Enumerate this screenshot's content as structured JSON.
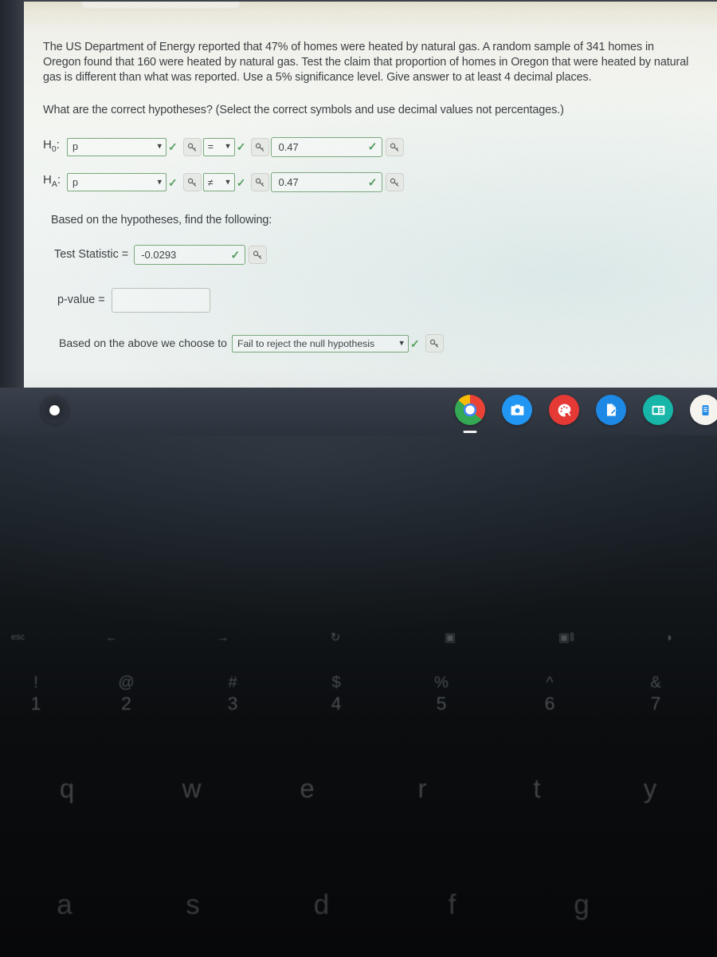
{
  "browser": {
    "page_background": "#f1f5f2",
    "ghost_widget_text": ""
  },
  "problem": {
    "statement": "The US Department of Energy reported that 47% of homes were heated by natural gas. A random sample of 341 homes in Oregon found that 160 were heated by natural gas. Test the claim that proportion of homes in Oregon that were heated by natural gas is different than what was reported. Use a 5% significance level. Give answer to at least 4 decimal places.",
    "question": "What are the correct hypotheses? (Select the correct symbols and use decimal values not percentages.)"
  },
  "hypotheses": {
    "null": {
      "label": "H₀:",
      "label_base": "H",
      "label_sub": "0",
      "parameter": "p",
      "operator": "=",
      "value": "0.47"
    },
    "alternative": {
      "label": "Hₐ:",
      "label_base": "H",
      "label_sub": "A",
      "parameter": "p",
      "operator": "≠",
      "value": "0.47"
    }
  },
  "followup": {
    "heading": "Based on the hypotheses, find the following:",
    "test_statistic_label": "Test Statistic =",
    "test_statistic_value": "-0.0293",
    "p_value_label": "p-value =",
    "p_value_value": "",
    "p_value_placeholder": "",
    "conclusion_label": "Based on the above we choose to",
    "conclusion_value": "Fail to reject the null hypothesis"
  },
  "icons": {
    "check": "✓",
    "chevron_down": "▾",
    "key": "key-icon"
  },
  "colors": {
    "valid_green": "#58a05f",
    "field_border_green": "#7aa87c",
    "shelf_dark": "#333a45",
    "chrome_blue": "#4285f4"
  },
  "shelf": {
    "launcher_label": "launcher",
    "apps": [
      {
        "name": "chrome",
        "label": "Google Chrome",
        "active": true
      },
      {
        "name": "camera",
        "label": "Camera",
        "active": false
      },
      {
        "name": "paint",
        "label": "Paint",
        "active": false
      },
      {
        "name": "notes",
        "label": "Notes",
        "active": false
      },
      {
        "name": "slides",
        "label": "Slides",
        "active": false
      },
      {
        "name": "edge",
        "label": "App",
        "active": false
      }
    ]
  },
  "keyboard": {
    "function_row": [
      "esc",
      "←",
      "→",
      "↻",
      "▣",
      "▣‖",
      "◑"
    ],
    "number_row": [
      {
        "top": "!",
        "bottom": "1"
      },
      {
        "top": "@",
        "bottom": "2"
      },
      {
        "top": "#",
        "bottom": "3"
      },
      {
        "top": "$",
        "bottom": "4"
      },
      {
        "top": "%",
        "bottom": "5"
      },
      {
        "top": "^",
        "bottom": "6"
      },
      {
        "top": "&",
        "bottom": "7"
      }
    ],
    "qwerty_row": [
      "q",
      "w",
      "e",
      "r",
      "t",
      "y"
    ],
    "asdf_row": [
      "a",
      "s",
      "d",
      "f",
      "g"
    ]
  }
}
